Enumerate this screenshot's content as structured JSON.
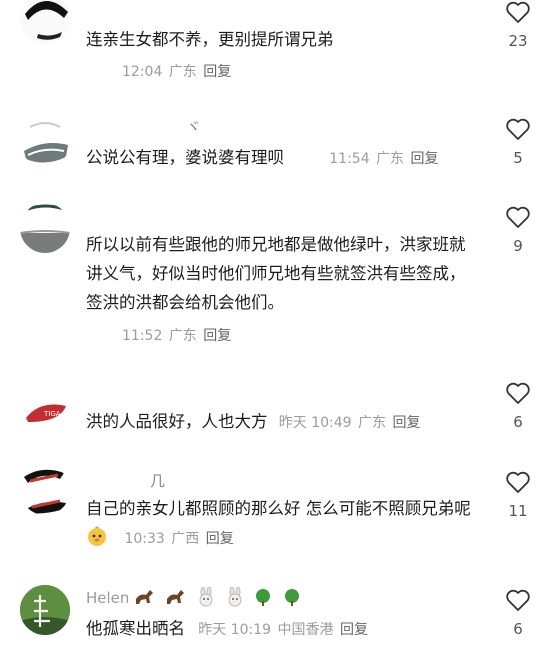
{
  "comments": [
    {
      "name": "",
      "text": "连亲生女都不养，更别提所谓兄弟",
      "time": "12:04",
      "location": "广东",
      "reply": "回复",
      "likes": "23"
    },
    {
      "name": "",
      "text": "公说公有理，婆说婆有理呗",
      "time": "11:54",
      "location": "广东",
      "reply": "回复",
      "likes": "5"
    },
    {
      "name": "",
      "text": "所以以前有些跟他的师兄地都是做他绿叶，洪家班就讲义气，好似当时他们师兄地有些就签洪有些签成，签洪的洪都会给机会他们。",
      "time": "11:52",
      "location": "广东",
      "reply": "回复",
      "likes": "9"
    },
    {
      "name": "",
      "text": "洪的人品很好，人也大方",
      "time": "昨天 10:49",
      "location": "广东",
      "reply": "回复",
      "likes": "6"
    },
    {
      "name": "",
      "text": "自己的亲女儿都照顾的那么好 怎么可能不照顾兄弟呢",
      "time": "10:33",
      "location": "广西",
      "reply": "回复",
      "likes": "11"
    },
    {
      "name": "Helen",
      "text": "他孤寒出晒名",
      "time": "昨天 10:19",
      "location": "中国香港",
      "reply": "回复",
      "likes": "6"
    }
  ],
  "icons": {
    "like": "heart-outline-icon",
    "reaction_emoji": "cute-face-emoji",
    "name_emojis": [
      "horse-emoji",
      "horse-emoji",
      "rabbit-emoji",
      "rabbit-emoji",
      "tree-emoji",
      "tree-emoji"
    ]
  },
  "colors": {
    "text": "#1c1c1c",
    "meta": "#9c9c9c",
    "background": "#ffffff"
  }
}
